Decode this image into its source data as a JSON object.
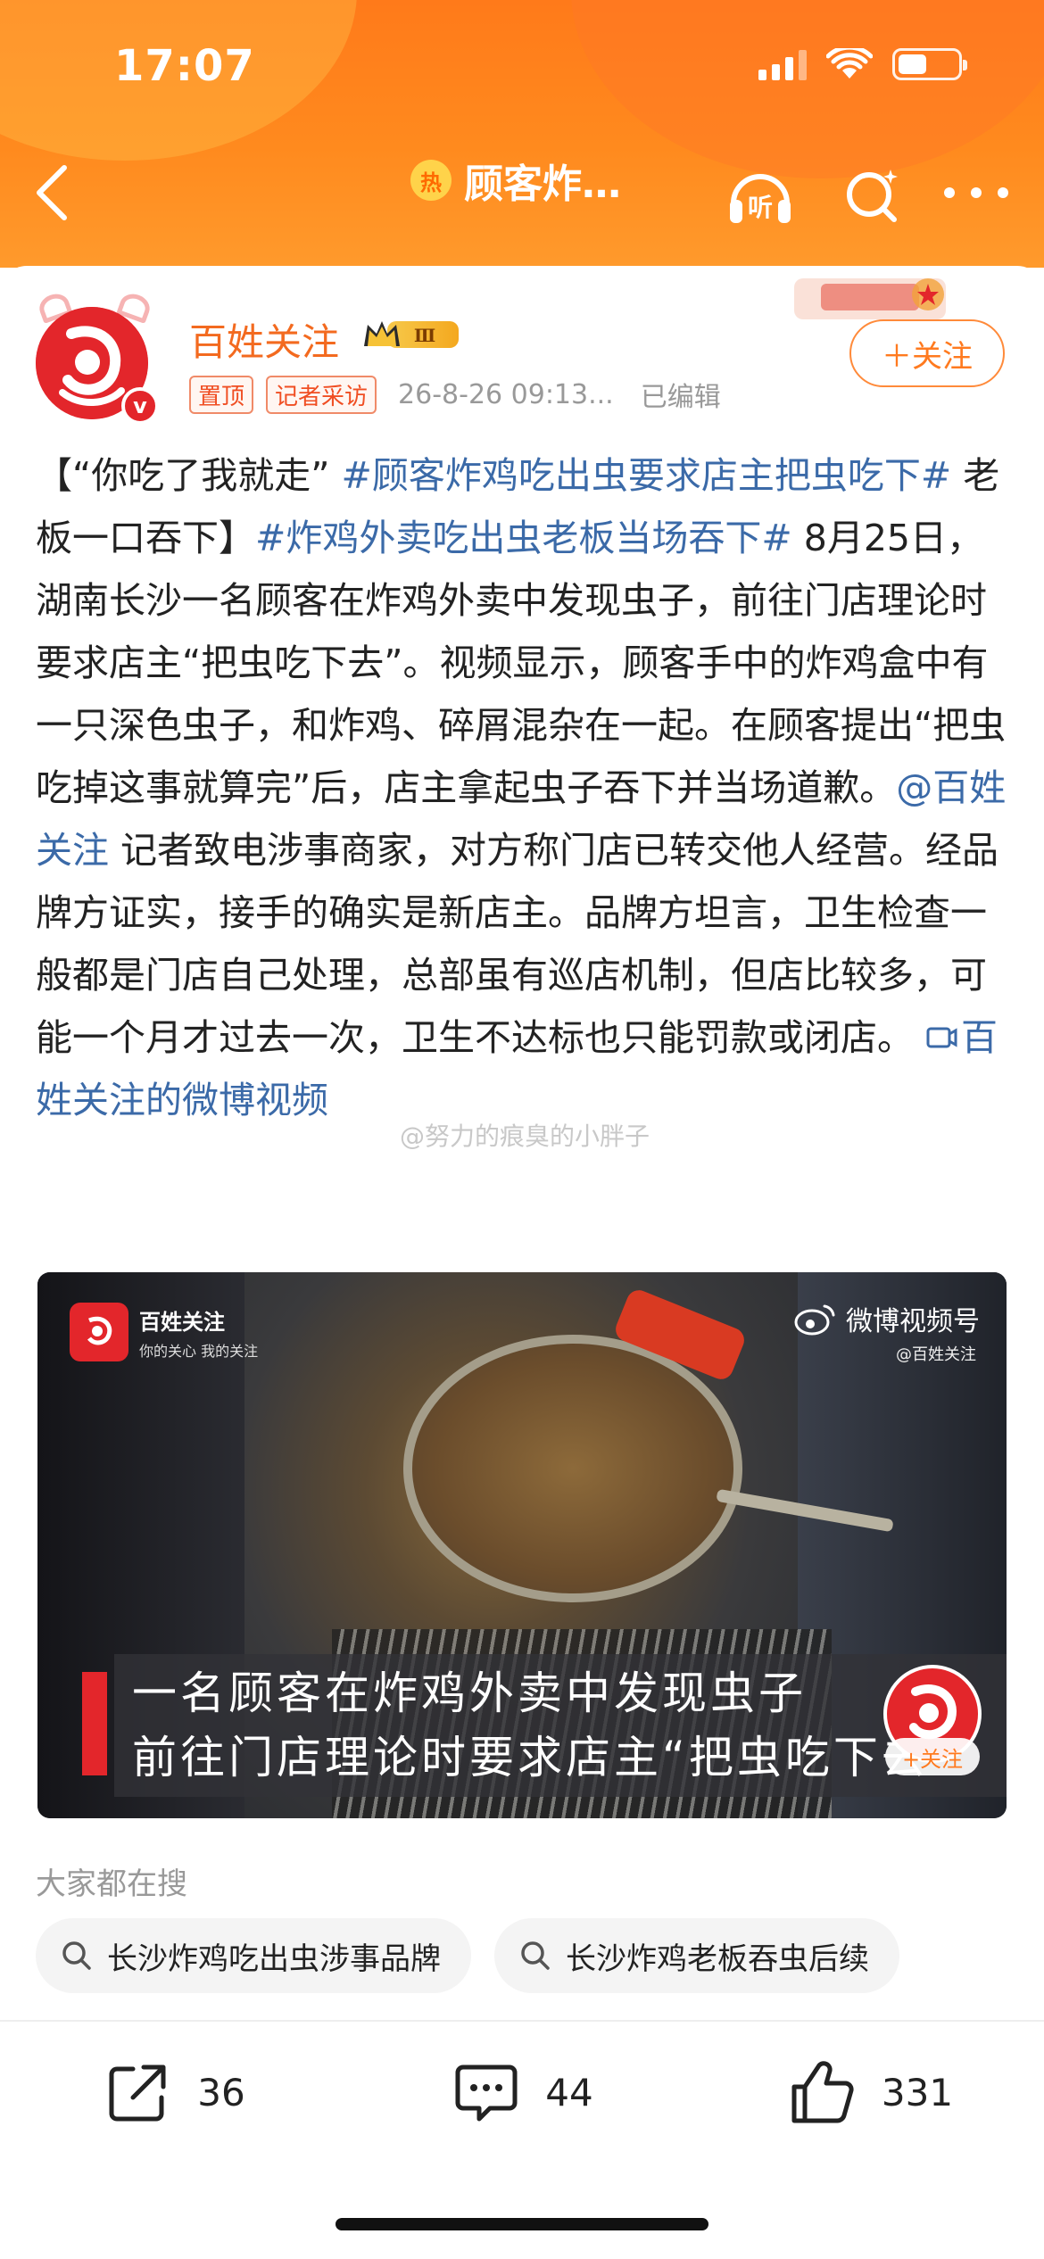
{
  "status_bar": {
    "time": "17:07"
  },
  "nav": {
    "hot_label": "热",
    "title": "顾客炸…"
  },
  "author": {
    "name": "百姓关注",
    "level_badge": "Ⅲ",
    "tags": [
      "置顶",
      "记者采访"
    ],
    "timestamp": "26-8-26 09:13...",
    "edited": "已编辑",
    "follow_label": "＋关注"
  },
  "post": {
    "segments": [
      {
        "type": "text",
        "text": "【“你吃了我就走” "
      },
      {
        "type": "topic",
        "text": "#顾客炸鸡吃出虫要求店主把虫吃下#"
      },
      {
        "type": "text",
        "text": " 老板一口吞下】"
      },
      {
        "type": "topic",
        "text": "#炸鸡外卖吃出虫老板当场吞下#"
      },
      {
        "type": "text",
        "text": " 8月25日，湖南长沙一名顾客在炸鸡外卖中发现虫子，前往门店理论时要求店主“把虫吃下去”。视频显示，顾客手中的炸鸡盒中有一只深色虫子，和炸鸡、碎屑混杂在一起。在顾客提出“把虫吃掉这事就算完”后，店主拿起虫子吞下并当场道歉。"
      },
      {
        "type": "mention",
        "text": "@百姓关注"
      },
      {
        "type": "text",
        "text": " 记者致电涉事商家，对方称门店已转交他人经营。经品牌方证实，接手的确实是新店主。品牌方坦言，卫生检查一般都是门店自己处理，总部虽有巡店机制，但店比较多，可能一个月才过去一次，卫生不达标也只能罚款或闭店。 "
      },
      {
        "type": "link",
        "text": "百姓关注的微博视频"
      }
    ],
    "watermark": "@努力的痕臭的小胖子"
  },
  "video": {
    "logo_name": "百姓关注",
    "logo_slogan": "你的关心 我的关注",
    "platform_watermark": "微博视频号",
    "platform_handle": "@百姓关注",
    "subtitle_line1": "一名顾客在炸鸡外卖中发现虫子",
    "subtitle_line2": "前往门店理论时要求店主“把虫吃下去”",
    "follow_label": "+关注"
  },
  "search": {
    "heading": "大家都在搜",
    "chips": [
      "长沙炸鸡吃出虫涉事品牌",
      "长沙炸鸡老板吞虫后续"
    ]
  },
  "actions": {
    "share_count": "36",
    "comment_count": "44",
    "like_count": "331"
  }
}
